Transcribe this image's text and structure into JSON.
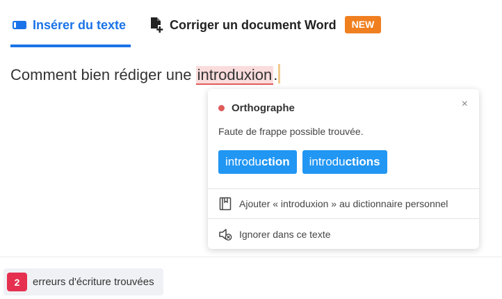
{
  "tabs": [
    {
      "label": "Insérer du texte",
      "icon": "keyboard-icon",
      "active": true,
      "color": "#1a73e8"
    },
    {
      "label": "Corriger un document Word",
      "icon": "document-add-icon",
      "active": false,
      "badge": "NEW",
      "badge_color": "#f07f1f"
    }
  ],
  "editor": {
    "text_before": "Comment bien rédiger une ",
    "error_word": "introduxion",
    "text_after": "."
  },
  "popup": {
    "category": "Orthographe",
    "category_color": "#e05a5a",
    "close_symbol": "×",
    "description": "Faute de frappe possible trouvée.",
    "suggestions": [
      {
        "prefix": "introdu",
        "bold": "ction"
      },
      {
        "prefix": "introdu",
        "bold": "ctions"
      }
    ],
    "suggestion_color": "#2196f3",
    "actions": [
      {
        "label": "Ajouter « introduxion » au dictionnaire personnel",
        "icon": "dictionary-icon"
      },
      {
        "label": "Ignorer dans ce texte",
        "icon": "ignore-icon"
      }
    ]
  },
  "status": {
    "error_count": "2",
    "label": "erreurs d'écriture trouvées",
    "count_color": "#e5304f"
  }
}
